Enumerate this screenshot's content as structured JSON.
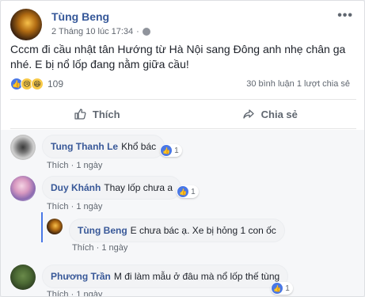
{
  "post": {
    "author": "Tùng Beng",
    "timestamp": "2 Tháng 10 lúc 17:34",
    "text": "Cccm đi cầu nhật tân Hướng từ Hà Nội sang Đông anh nhẹ chân ga nhé. E bị nổ lốp đang nằm giữa cầu!",
    "more_label": "•••",
    "reaction_count": "109",
    "comment_count": "30 bình luận",
    "share_count": "1 lượt chia sẻ",
    "colors": {
      "link": "#385898",
      "like": "#4a78e6",
      "emoji": "#f7c948"
    }
  },
  "actions": {
    "like_label": "Thích",
    "share_label": "Chia sẻ"
  },
  "comments": [
    {
      "name": "Tung Thanh Le",
      "text": "Khổ bác",
      "likes": "1",
      "like_label": "Thích",
      "time": "1 ngày"
    },
    {
      "name": "Duy Khánh",
      "text": "Thay lốp chưa a",
      "likes": "1",
      "like_label": "Thích",
      "time": "1 ngày"
    },
    {
      "name": "Tùng Beng",
      "text": "E chưa bác ạ. Xe bị hỏng 1 con ốc",
      "like_label": "Thích",
      "time": "1 ngày"
    },
    {
      "name": "Phương Trần",
      "text": "M đi làm mẫu ở đâu mà nổ lốp thế tùng",
      "likes": "1",
      "like_label": "Thích",
      "time": "1 ngày"
    }
  ],
  "separator": "·"
}
